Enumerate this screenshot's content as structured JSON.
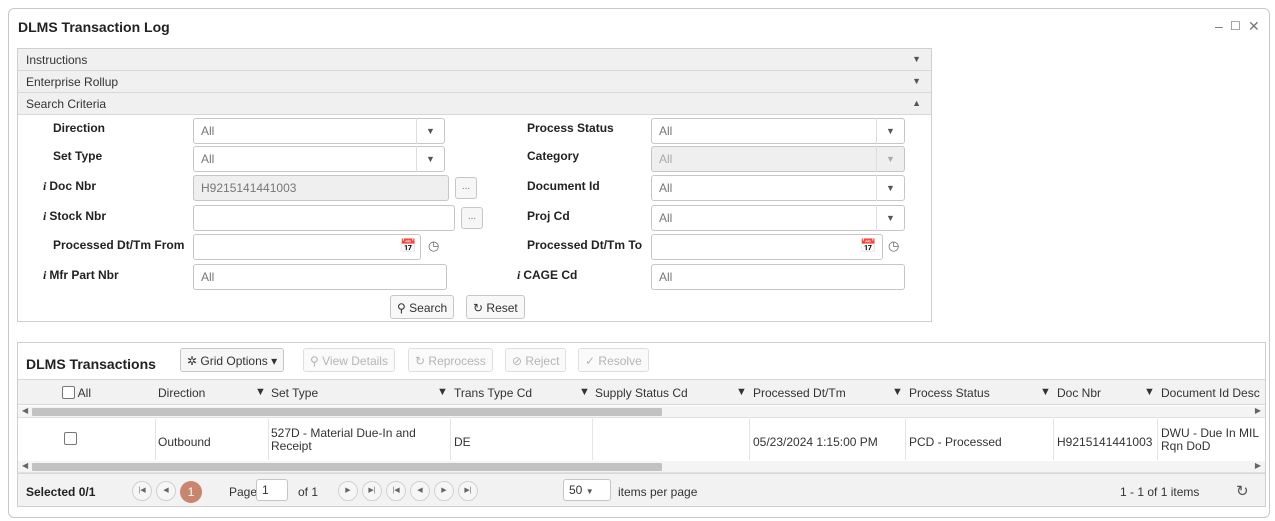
{
  "window": {
    "title": "DLMS Transaction Log",
    "minimize": "–",
    "maximize": "☐",
    "close": "✕"
  },
  "accordion": {
    "instructions": "Instructions",
    "enterprise_rollup": "Enterprise Rollup",
    "search_criteria": "Search Criteria"
  },
  "search": {
    "direction": {
      "label": "Direction",
      "value": "All"
    },
    "set_type": {
      "label": "Set Type",
      "value": "All"
    },
    "doc_nbr": {
      "label": "Doc Nbr",
      "value": "H9215141441003"
    },
    "stock_nbr": {
      "label": "Stock Nbr",
      "value": ""
    },
    "processed_from": {
      "label": "Processed Dt/Tm From",
      "value": ""
    },
    "mfr_part_nbr": {
      "label": "Mfr Part Nbr",
      "value": "All"
    },
    "process_status": {
      "label": "Process Status",
      "value": "All"
    },
    "category": {
      "label": "Category",
      "value": "All"
    },
    "document_id": {
      "label": "Document Id",
      "value": "All"
    },
    "proj_cd": {
      "label": "Proj Cd",
      "value": "All"
    },
    "processed_to": {
      "label": "Processed Dt/Tm To",
      "value": ""
    },
    "cage_cd": {
      "label": "CAGE Cd",
      "value": "All"
    },
    "search_btn": "Search",
    "reset_btn": "Reset",
    "ellipsis": "..."
  },
  "grid": {
    "title": "DLMS Transactions",
    "toolbar": {
      "grid_options": "Grid Options ▾",
      "view_details": "View Details",
      "reprocess": "Reprocess",
      "reject": "Reject",
      "resolve": "Resolve"
    },
    "columns": {
      "all": "All",
      "direction": "Direction",
      "set_type": "Set Type",
      "trans_type_cd": "Trans Type Cd",
      "supply_status_cd": "Supply Status Cd",
      "processed_dt_tm": "Processed Dt/Tm",
      "process_status": "Process Status",
      "doc_nbr": "Doc Nbr",
      "document_id_desc": "Document Id Desc"
    },
    "rows": [
      {
        "direction": "Outbound",
        "set_type_line1": "527D - Material Due-In and",
        "set_type_line2": "Receipt",
        "trans_type_cd": "DE",
        "supply_status_cd": "",
        "processed_dt_tm": "05/23/2024 1:15:00 PM",
        "process_status": "PCD - Processed",
        "doc_nbr": "H9215141441003",
        "doc_id_desc_line1": "DWU - Due In MIL",
        "doc_id_desc_line2": "Rqn DoD"
      }
    ],
    "pager": {
      "selected": "Selected 0/1",
      "current_page": "1",
      "page_label": "Page",
      "page_input": "1",
      "of_label": "of 1",
      "page_size": "50",
      "items_per_page": "items per page",
      "range": "1 - 1 of 1 items"
    }
  },
  "colors": {
    "accent": "#c8866e",
    "header_bg": "#f2f2f2"
  }
}
